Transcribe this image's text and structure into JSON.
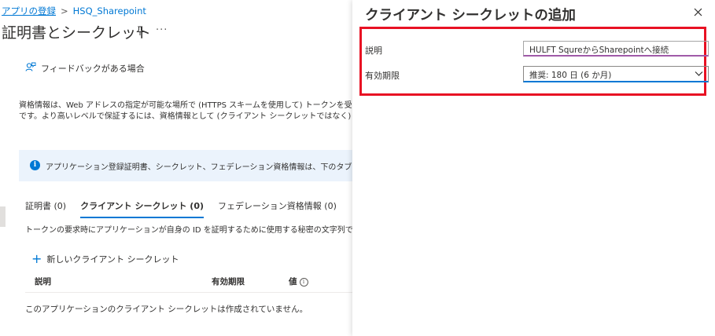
{
  "breadcrumb": {
    "parent": "アプリの登録",
    "separator": ">",
    "current": "HSQ_Sharepoint"
  },
  "page": {
    "title": "証明書とシークレット",
    "more": "···",
    "feedback": "フィードバックがある場合",
    "description_line1": "資格情報は、Web アドレスの指定が可能な場所で (HTTPS スキームを使用して) トークンを受信する際に",
    "description_line2": "です。より高いレベルで保証するには、資格情報として (クライアント シークレットではなく) 証明書を使うこと",
    "banner_text": "アプリケーション登録証明書、シークレット、フェデレーション資格情報は、下のタブにあります。",
    "tabs": [
      {
        "label": "証明書 (0)",
        "active": false
      },
      {
        "label": "クライアント シークレット (0)",
        "active": true
      },
      {
        "label": "フェデレーション資格情報 (0)",
        "active": false
      }
    ],
    "tab_description": "トークンの要求時にアプリケーションが自身の ID を証明するために使用する秘密の文字列です。アプリケ",
    "new_secret_label": "新しいクライアント シークレット",
    "table_headers": {
      "description": "説明",
      "expires": "有効期限",
      "value": "値"
    },
    "empty_message": "このアプリケーションのクライアント シークレットは作成されていません。"
  },
  "panel": {
    "title": "クライアント シークレットの追加",
    "close": "×",
    "description_label": "説明",
    "description_value": "HULFT SqureからSharepointへ接続",
    "expires_label": "有効期限",
    "expires_selected": "推奨: 180 日 (6 か月)"
  },
  "colors": {
    "accent": "#0078d4",
    "highlight_border": "#e81123",
    "banner_bg": "#ebf3fc"
  },
  "icons": [
    "pin-icon",
    "feedback-icon",
    "info-icon",
    "plus-icon",
    "close-icon",
    "chevron-down-icon"
  ]
}
